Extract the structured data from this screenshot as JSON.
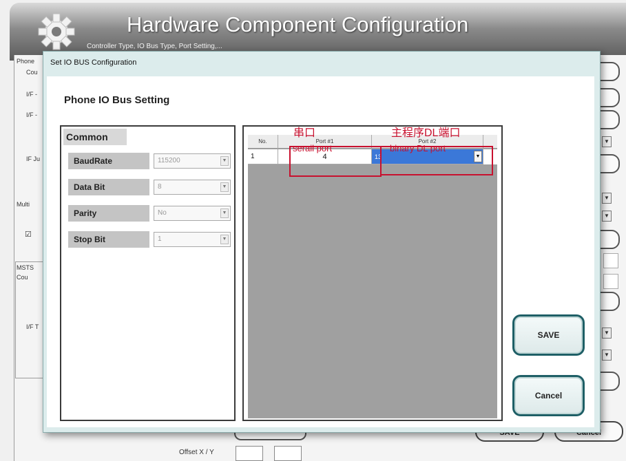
{
  "background": {
    "title": "Hardware Component Configuration",
    "subtitle": "Controller Type, IO Bus Type, Port Setting,...",
    "left_labels": [
      "Phone",
      "Cou",
      "I/F -",
      "I/F -",
      "IF Ju",
      "IF Ju",
      "Multi",
      "MSTS",
      "Cou",
      "I/F T"
    ],
    "offset_label": "Offset X / Y",
    "save_label": "SAVE",
    "cancel_label": "Cancel"
  },
  "dialog": {
    "title": "Set IO BUS Configuration",
    "section_title": "Phone IO Bus Setting",
    "common": {
      "title": "Common",
      "fields": [
        {
          "label": "BaudRate",
          "value": "115200"
        },
        {
          "label": "Data Bit",
          "value": "8"
        },
        {
          "label": "Parity",
          "value": "No"
        },
        {
          "label": "Stop Bit",
          "value": "1"
        }
      ]
    },
    "grid": {
      "columns": [
        "No.",
        "Port #1",
        "Port #2"
      ],
      "rows": [
        {
          "no": "1",
          "port1": "4",
          "port2": "13"
        }
      ]
    },
    "annotations": {
      "serial_cn": "串口",
      "serial_en": "serail port",
      "binary_cn": "主程序DL端口",
      "binary_en": "binary DL port"
    },
    "save_label": "SAVE",
    "cancel_label": "Cancel"
  },
  "colors": {
    "annotation": "#c8102e",
    "selection": "#3b78d8",
    "button_border": "#1e5f66"
  }
}
